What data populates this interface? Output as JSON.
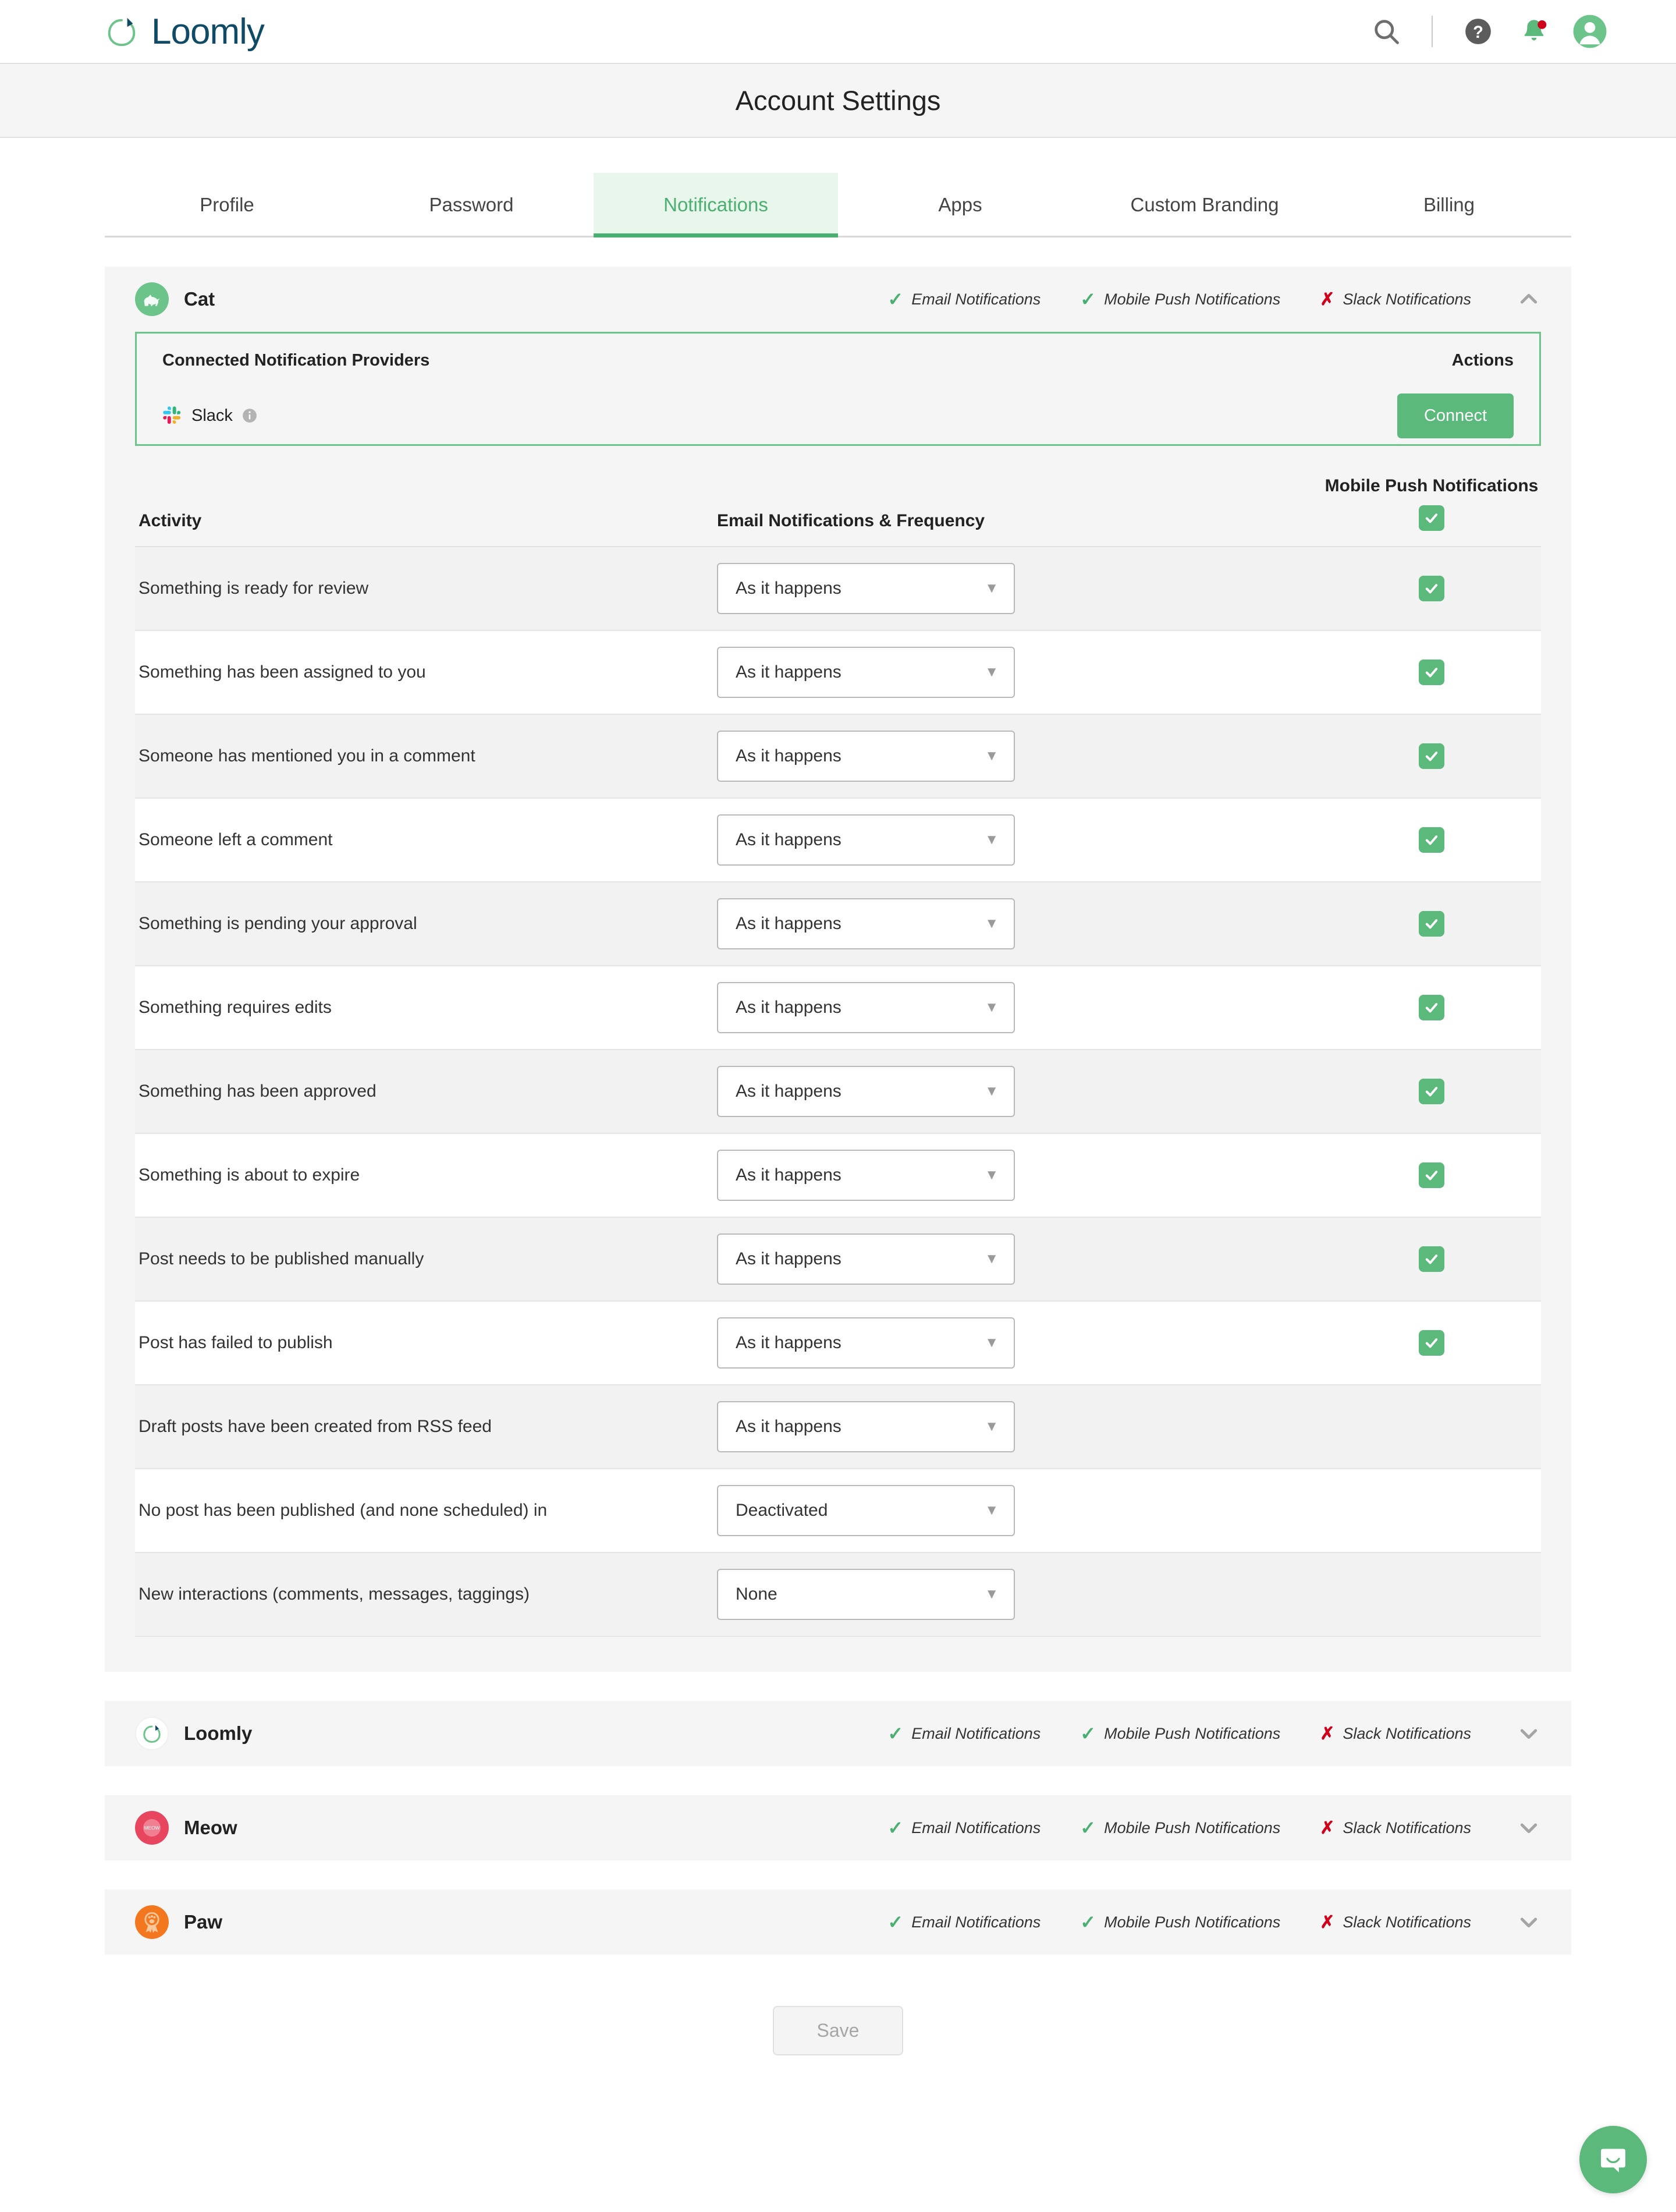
{
  "brand": {
    "name": "Loomly"
  },
  "header": {
    "search_icon": "search-icon",
    "help_icon": "help-circle-icon",
    "bell_icon": "bell-icon",
    "avatar_icon": "user-avatar-icon",
    "title": "Account Settings"
  },
  "tabs": [
    {
      "label": "Profile",
      "active": false
    },
    {
      "label": "Password",
      "active": false
    },
    {
      "label": "Notifications",
      "active": true
    },
    {
      "label": "Apps",
      "active": false
    },
    {
      "label": "Custom Branding",
      "active": false
    },
    {
      "label": "Billing",
      "active": false
    }
  ],
  "statuses": {
    "email": "Email Notifications",
    "push": "Mobile Push Notifications",
    "slack": "Slack Notifications"
  },
  "providers": {
    "title": "Connected Notification Providers",
    "actions_label": "Actions",
    "slack_label": "Slack",
    "info_icon": "info-icon",
    "connect_label": "Connect"
  },
  "table": {
    "col_activity": "Activity",
    "col_email": "Email Notifications & Frequency",
    "col_push": "Mobile Push Notifications",
    "rows": [
      {
        "label": "Something is ready for review",
        "frequency": "As it happens",
        "push": true
      },
      {
        "label": "Something has been assigned to you",
        "frequency": "As it happens",
        "push": true
      },
      {
        "label": "Someone has mentioned you in a comment",
        "frequency": "As it happens",
        "push": true
      },
      {
        "label": "Someone left a comment",
        "frequency": "As it happens",
        "push": true
      },
      {
        "label": "Something is pending your approval",
        "frequency": "As it happens",
        "push": true
      },
      {
        "label": "Something requires edits",
        "frequency": "As it happens",
        "push": true
      },
      {
        "label": "Something has been approved",
        "frequency": "As it happens",
        "push": true
      },
      {
        "label": "Something is about to expire",
        "frequency": "As it happens",
        "push": true
      },
      {
        "label": "Post needs to be published manually",
        "frequency": "As it happens",
        "push": true
      },
      {
        "label": "Post has failed to publish",
        "frequency": "As it happens",
        "push": true
      },
      {
        "label": "Draft posts have been created from RSS feed",
        "frequency": "As it happens",
        "push": false
      },
      {
        "label": "No post has been published (and none scheduled) in",
        "frequency": "Deactivated",
        "push": false
      },
      {
        "label": "New interactions (comments, messages, taggings)",
        "frequency": "None",
        "push": false
      }
    ]
  },
  "accounts": [
    {
      "name": "Cat",
      "avatar": "cat-avatar",
      "expanded": true
    },
    {
      "name": "Loomly",
      "avatar": "loomly-avatar",
      "expanded": false
    },
    {
      "name": "Meow",
      "avatar": "meow-avatar",
      "expanded": false
    },
    {
      "name": "Paw",
      "avatar": "paw-avatar",
      "expanded": false
    }
  ],
  "footer": {
    "save_label": "Save"
  },
  "chat": {
    "icon": "chat-bubble-icon"
  },
  "colors": {
    "green": "#5cb97c",
    "green_light": "#e8f6ec",
    "navy": "#0f4a66",
    "red": "#d0021b",
    "panel_bg": "#f5f5f5"
  }
}
